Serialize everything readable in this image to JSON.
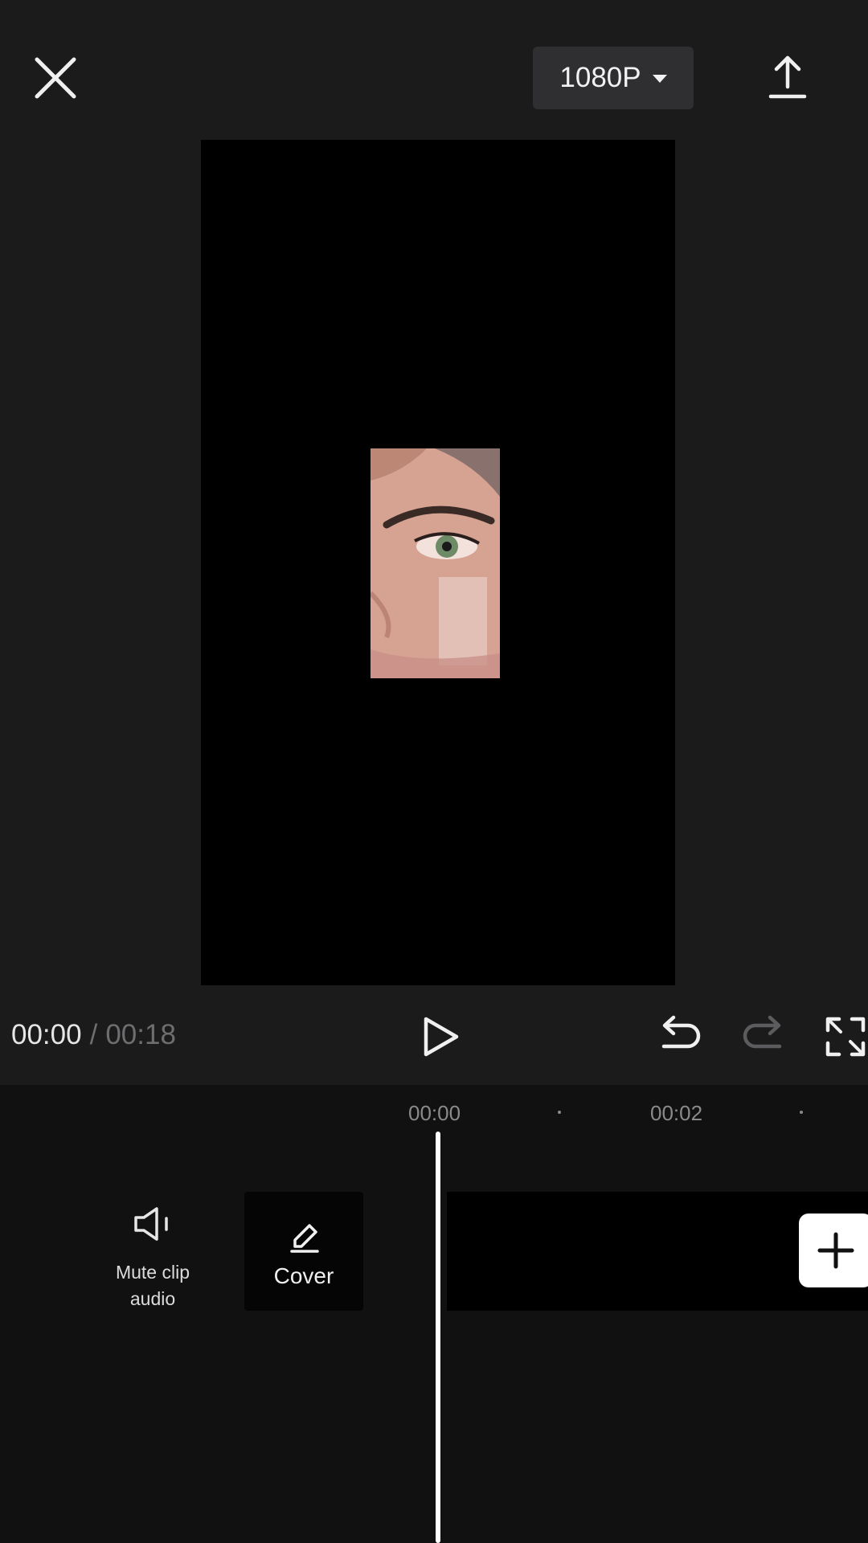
{
  "top_bar": {
    "close_icon": "close-icon",
    "resolution_label": "1080P",
    "resolution_icon": "caret-down-icon",
    "export_icon": "export-upload-icon"
  },
  "player": {
    "current_time": "00:00",
    "separator": "/",
    "total_time": "00:18",
    "play_icon": "play-icon",
    "undo_icon": "undo-icon",
    "redo_icon": "redo-icon",
    "fullscreen_icon": "fullscreen-icon"
  },
  "timeline": {
    "ruler": {
      "labels": [
        "00:00",
        "00:02"
      ]
    },
    "mute_label": "Mute clip audio",
    "mute_label_line1": "Mute clip",
    "mute_label_line2": "audio",
    "mute_icon": "speaker-icon",
    "cover_label": "Cover",
    "cover_icon": "edit-pencil-icon",
    "add_icon": "plus-icon"
  },
  "colors": {
    "background": "#1b1b1c",
    "timeline_bg": "#111112",
    "preview_bg": "#000000",
    "button_bg": "#2f2f31",
    "muted_text": "#6e6e70",
    "playhead": "#ffffff"
  }
}
